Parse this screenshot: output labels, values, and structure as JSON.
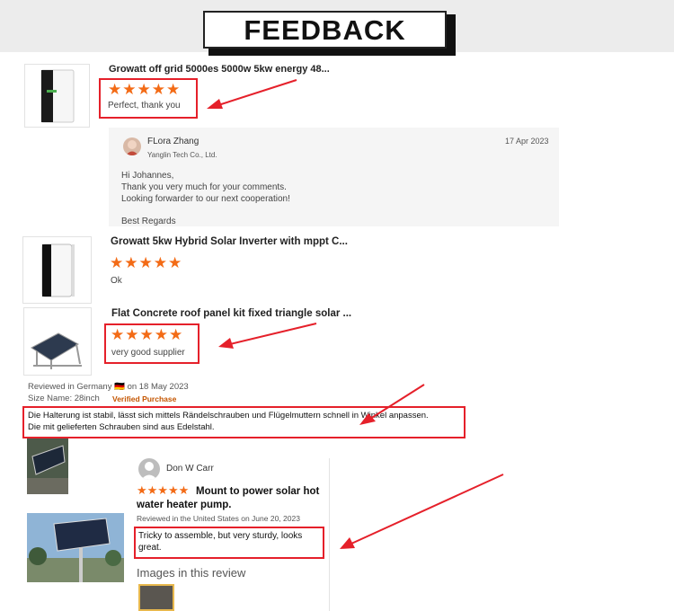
{
  "banner": {
    "title": "FEEDBACK"
  },
  "review1": {
    "product_title": "Growatt off grid 5000es 5000w 5kw energy 48...",
    "stars": "★★★★★",
    "comment": "Perfect, thank you"
  },
  "reply": {
    "name": "FLora Zhang",
    "company": "Yanglin Tech Co., Ltd.",
    "date": "17 Apr 2023",
    "line1": "Hi Johannes,",
    "line2": "Thank you very much for your comments.",
    "line3": "Looking forwarder to our next cooperation!",
    "line4": "Best Regards"
  },
  "review2": {
    "product_title": "Growatt 5kw Hybrid Solar Inverter with mppt C...",
    "stars": "★★★★★",
    "comment": "Ok"
  },
  "review3": {
    "product_title": "Flat Concrete roof panel kit fixed triangle solar ...",
    "stars": "★★★★★",
    "comment": "very good supplier"
  },
  "review4": {
    "meta1": "Reviewed in Germany 🇩🇪 on 18 May 2023",
    "meta2": "Size Name: 28inch",
    "verified": "Verified Purchase",
    "text1": "Die Halterung ist stabil, lässt sich mittels Rändelschrauben und Flügelmuttern schnell in Winkel anpassen.",
    "text2": "Die mit gelieferten Schrauben sind aus Edelstahl."
  },
  "review5": {
    "name": "Don W Carr",
    "stars": "★★★★★",
    "headline": "Mount to power solar hot water heater pump.",
    "meta": "Reviewed in the United States on June 20, 2023",
    "comment": "Tricky to assemble, but very sturdy, looks great.",
    "images_label": "Images in this review"
  },
  "colors": {
    "accent_red": "#e5202a",
    "star_orange": "#f36b16"
  }
}
